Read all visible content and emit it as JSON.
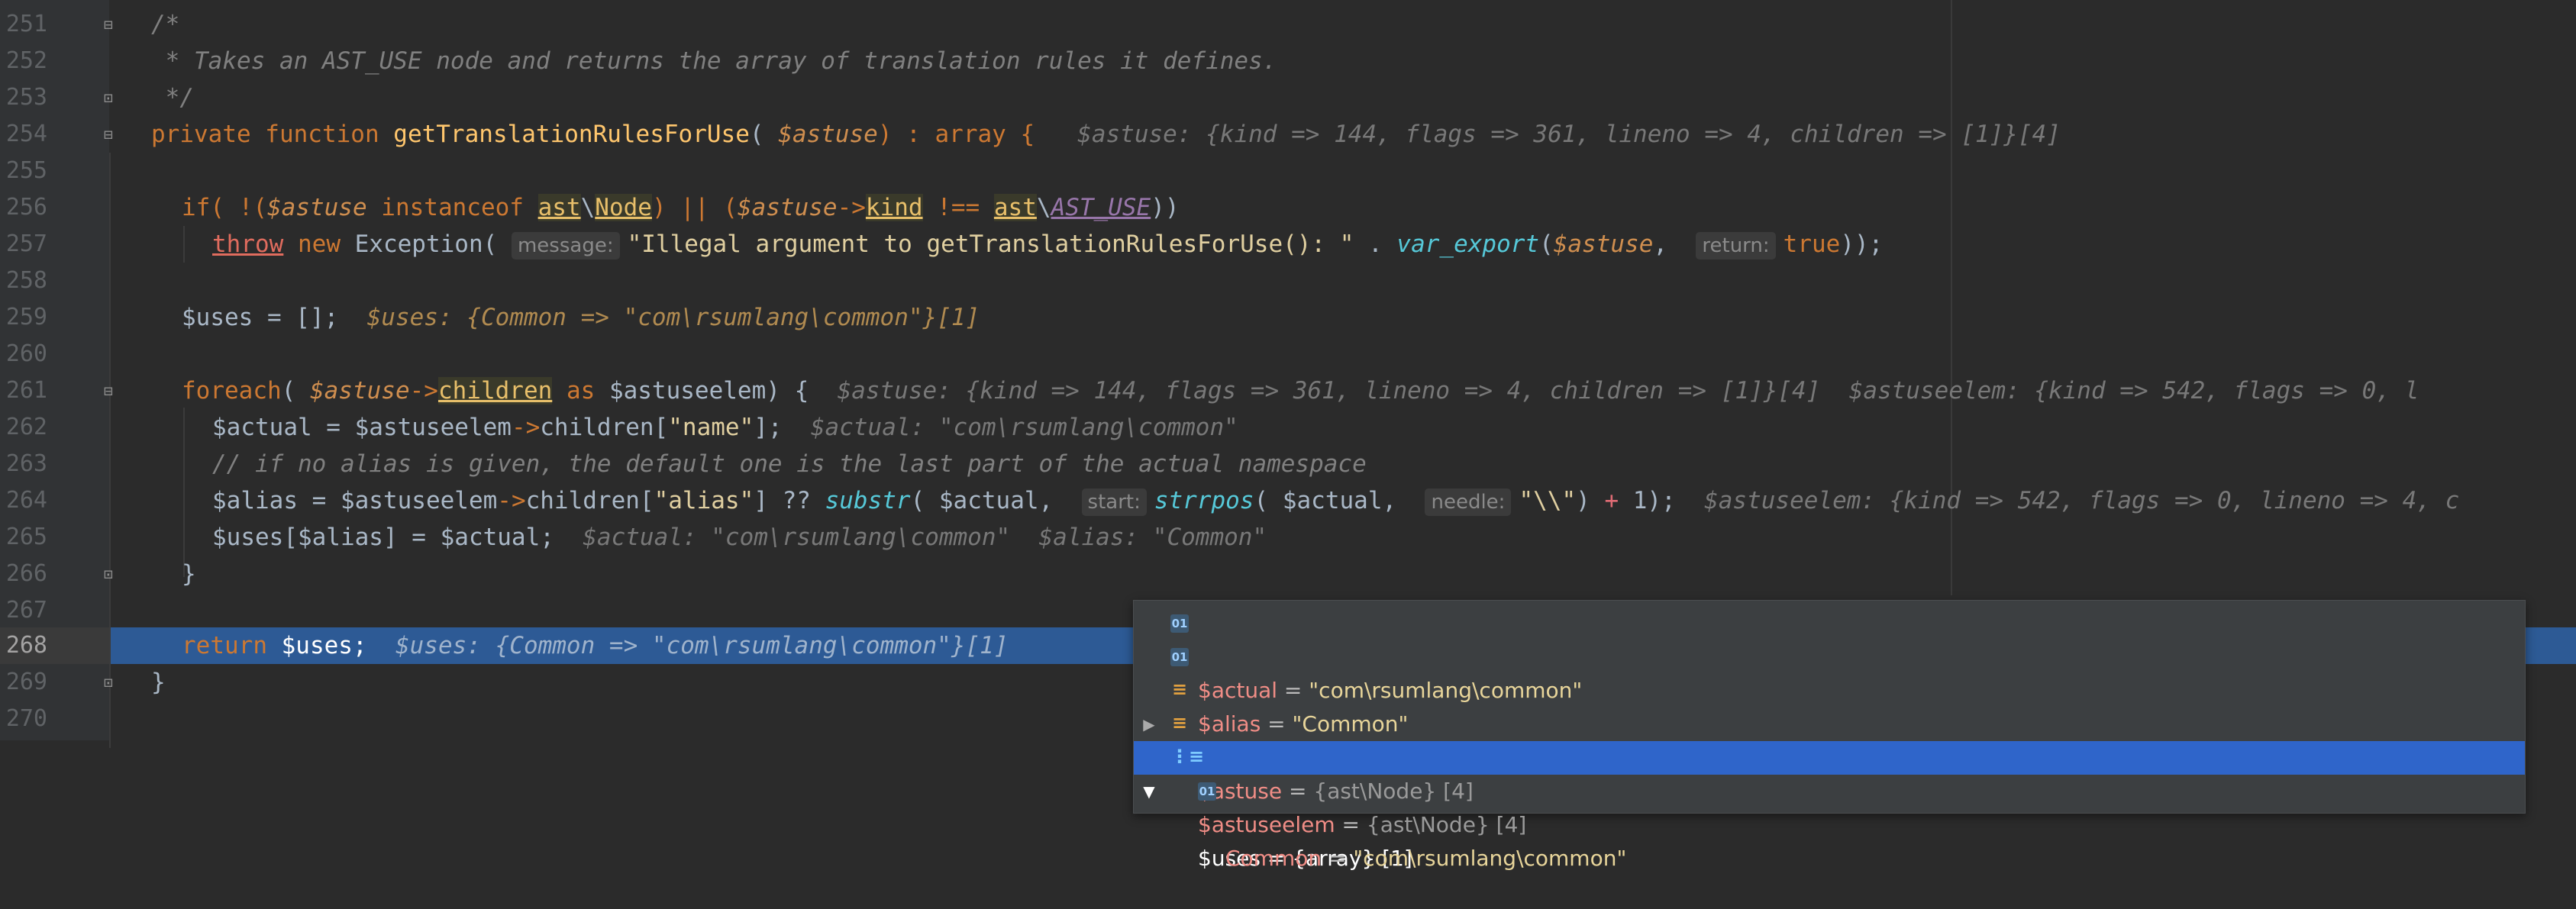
{
  "editor": {
    "lines": [
      {
        "num": "251"
      },
      {
        "num": "252"
      },
      {
        "num": "253"
      },
      {
        "num": "254"
      },
      {
        "num": "255"
      },
      {
        "num": "256"
      },
      {
        "num": "257"
      },
      {
        "num": "258"
      },
      {
        "num": "259"
      },
      {
        "num": "260"
      },
      {
        "num": "261"
      },
      {
        "num": "262"
      },
      {
        "num": "263"
      },
      {
        "num": "264"
      },
      {
        "num": "265"
      },
      {
        "num": "266"
      },
      {
        "num": "267"
      },
      {
        "num": "268"
      },
      {
        "num": "269"
      },
      {
        "num": "270"
      }
    ],
    "code": {
      "l251": "/*",
      "l252": " * Takes an AST_USE node and returns the array of translation rules it defines.",
      "l253": " */",
      "l254_kw": "private function ",
      "l254_fn": "getTranslationRulesForUse",
      "l254_open": "( ",
      "l254_var": "$astuse",
      "l254_rest": ") : array {",
      "l254_hint": "$astuse: {kind => 144, flags => 361, lineno => 4, children => [1]}[4]",
      "l256_if": "if",
      "l256_a": "( !(",
      "l256_var1": "$astuse",
      "l256_inst": " instanceof ",
      "l256_ns": "ast",
      "l256_bs": "\\",
      "l256_node": "Node",
      "l256_b": ") || (",
      "l256_var2": "$astuse",
      "l256_arrow": "->",
      "l256_kind": "kind",
      "l256_neq": " !== ",
      "l256_ns2": "ast",
      "l256_bs2": "\\",
      "l256_const": "AST_USE",
      "l256_end": "))",
      "l257_throw": "throw",
      "l257_new": " new ",
      "l257_exc": "Exception( ",
      "l257_p1": "message:",
      "l257_str": "\"Illegal argument to getTranslationRulesForUse(): \"",
      "l257_dot": " . ",
      "l257_fn": "var_export",
      "l257_open": "(",
      "l257_var": "$astuse",
      "l257_comma": ",  ",
      "l257_p2": "return:",
      "l257_true": "true",
      "l257_end": "));",
      "l259_code": "$uses = [];",
      "l259_hint": "$uses: {Common => \"com\\rsumlang\\common\"}[1]",
      "l261_kw": "foreach",
      "l261_open": "( ",
      "l261_var": "$astuse",
      "l261_arrow": "->",
      "l261_children": "children",
      "l261_as": " as ",
      "l261_rest": "$astuseelem) {",
      "l261_hint1": "$astuse: {kind => 144, flags => 361, lineno => 4, children => [1]}[4]",
      "l261_hint2": "$astuseelem: {kind => 542, flags => 0, l",
      "l262_a": "$actual = $astuseelem",
      "l262_arrow": "->",
      "l262_b": "children[",
      "l262_str": "\"name\"",
      "l262_c": "];",
      "l262_hint": "$actual: \"com\\rsumlang\\common\"",
      "l263": "// if no alias is given, the default one is the last part of the actual namespace",
      "l264_a": "$alias = $astuseelem",
      "l264_arrow": "->",
      "l264_b": "children[",
      "l264_str": "\"alias\"",
      "l264_c": "] ?? ",
      "l264_fn": "substr",
      "l264_d": "( $actual,  ",
      "l264_p1": "start:",
      "l264_fn2": "strrpos",
      "l264_e": "( $actual,  ",
      "l264_p2": "needle:",
      "l264_str2": "\"\\\\\"",
      "l264_f": ") ",
      "l264_plus": "+",
      "l264_g": " 1);",
      "l264_hint": "$astuseelem: {kind => 542, flags => 0, lineno => 4, c",
      "l265_code": "$uses[$alias] = $actual;",
      "l265_hint": "$actual: \"com\\rsumlang\\common\"  $alias: \"Common\"",
      "l266": "}",
      "l268_kw": "return",
      "l268_code": " $uses;",
      "l268_hint": "$uses: {Common => \"com\\rsumlang\\common\"}[1]",
      "l269": "}"
    }
  },
  "debug_popup": {
    "rows": [
      {
        "name": "$actual",
        "eq": " = ",
        "value": "\"com\\rsumlang\\common\"",
        "type": "",
        "expander": "",
        "icon": "val"
      },
      {
        "name": "$alias",
        "eq": " = ",
        "value": "\"Common\"",
        "type": "",
        "expander": "",
        "icon": "val"
      },
      {
        "name": "$astuse",
        "eq": " = ",
        "value": "",
        "type": "{ast\\Node} [4]",
        "expander": "▶",
        "icon": "obj"
      },
      {
        "name": "$astuseelem",
        "eq": " = ",
        "value": "",
        "type": "{ast\\Node} [4]",
        "expander": "▶",
        "icon": "obj"
      },
      {
        "name": "$uses",
        "eq": " = ",
        "value": "",
        "type": "{array} [1]",
        "expander": "▼",
        "icon": "arr",
        "selected": true
      },
      {
        "name": "Common",
        "eq": " = ",
        "value": "\"com\\rsumlang\\common\"",
        "type": "",
        "expander": "",
        "icon": "val",
        "child": true
      }
    ]
  },
  "colors": {
    "background": "#2b2b2b",
    "execution_line": "#2d5a95",
    "popup_selected": "#2f65ca"
  }
}
